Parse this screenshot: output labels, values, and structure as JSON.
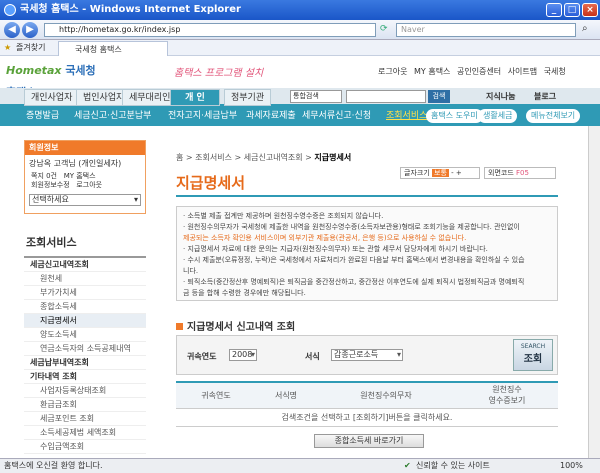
{
  "window": {
    "title": "국세청 홈택스 - Windows Internet Explorer"
  },
  "browser": {
    "url": "http://hometax.go.kr/index.jsp",
    "search_placeholder": "Naver",
    "fav_label": "즐겨찾기",
    "tab_title": "국세청 홈택스"
  },
  "site": {
    "logo_main": "Hometax",
    "logo_org": "국세청 홈택스",
    "slogan": "홈택스 프로그램 설치",
    "top_links": [
      "로그아웃",
      "MY 홈택스",
      "공인인증센터",
      "사이트맵",
      "국세청"
    ],
    "search_select": "통합검색",
    "search_button": "검색",
    "knowledge": "지식나눔",
    "blog": "블로그"
  },
  "nav1": [
    "개인사업자",
    "법인사업자",
    "세무대리인",
    "개 인",
    "정부기관"
  ],
  "nav2": [
    "증명발급",
    "세금신고·신고분납부",
    "전자고지·세금납부",
    "과세자료제출",
    "세무서류신고·신청",
    "조회서비스"
  ],
  "nav2_right": [
    "홈택스 도우미",
    "생활세금",
    "메뉴전체보기"
  ],
  "login": {
    "header": "회원정보",
    "name_line": "강남옥 고객님 (개인일세자)",
    "items": [
      "쪽지 0건",
      "MY 홈택스",
      "회원정보수정",
      "로그아웃"
    ],
    "select": "선택하세요"
  },
  "left_menu": {
    "title": "조회서비스",
    "items": [
      {
        "label": "세금신고내역조회",
        "type": "cat"
      },
      {
        "label": "원천세",
        "type": "sub"
      },
      {
        "label": "부가가치세",
        "type": "sub"
      },
      {
        "label": "종합소득세",
        "type": "sub"
      },
      {
        "label": "지급명세서",
        "type": "sub",
        "active": true
      },
      {
        "label": "양도소득세",
        "type": "sub"
      },
      {
        "label": "연금소득자의 소득공제내역",
        "type": "sub"
      },
      {
        "label": "세금납부내역조회",
        "type": "cat"
      },
      {
        "label": "기타내역 조회",
        "type": "cat"
      },
      {
        "label": "사업자등록상태조회",
        "type": "sub"
      },
      {
        "label": "환급금조회",
        "type": "sub"
      },
      {
        "label": "세금포인트 조회",
        "type": "sub"
      },
      {
        "label": "소득세공제법 세액조회",
        "type": "sub"
      },
      {
        "label": "수입금액조회",
        "type": "sub"
      }
    ]
  },
  "main": {
    "breadcrumb": "홈 > 조회서비스 > 세금신고내역조회 > ",
    "breadcrumb_current": "지급명세서",
    "title": "지급명세서",
    "font_size_label": "글자크기",
    "font_size_value": "보통",
    "font_size_minus": "-",
    "font_size_plus": "+",
    "ext_label": "외면코드",
    "ext_value": "F05",
    "info": [
      "· 소득별 제출 접계만 제공하며 원천징수영수증은 조회되지 않습니다.",
      "· 원천징수의무자가 국세청에 제출한 내역을 원천징수영수증(소득자보관용)형태로 조회기능을 제공합니다. 관인없이",
      "  제공되는 소득자 확인용 서비스이며 외부기관 제출용(관공서, 은행 등)으로 사용하실 수 없습니다.",
      "· 지급명세서 자료에 대한 문의는 지급자(원천징수의무자) 또는 관할 세무서 담당자에게 하시기 바랍니다.",
      "· 수시 제출분(오류정정, 누락)은 국세청에서 자료처리가 완료된 다음날 부터 홈택스에서 변경내용을 확인하실 수 있습",
      "  니다.",
      "· 퇴직소득(중간정산후 명예퇴직)은 퇴직금을 중간정산하고, 중간정산 이후연도에 실제 퇴직시 법정퇴직금과 명예퇴직",
      "  금 등을 합해 수령한 경우에만 해당됩니다."
    ],
    "section_title": "지급명세서 신고내역 조회",
    "year_label": "귀속연도",
    "year_value": "2008",
    "form_label": "서식",
    "form_value": "갑종근로소득",
    "search_en": "SEARCH",
    "search_ko": "조회",
    "table_headers": [
      "귀속연도",
      "서식명",
      "원천징수의무자",
      "원천징수\n영수증보기"
    ],
    "empty_msg": "검색조건을 선택하고 [조회하기]버튼을 클릭하세요.",
    "result_button": "종합소득세 바로가기"
  },
  "status": {
    "left": "홈택스에 오신걸 환영 합니다.",
    "zone": "신뢰할 수 있는 사이트",
    "zoom": "100%"
  }
}
